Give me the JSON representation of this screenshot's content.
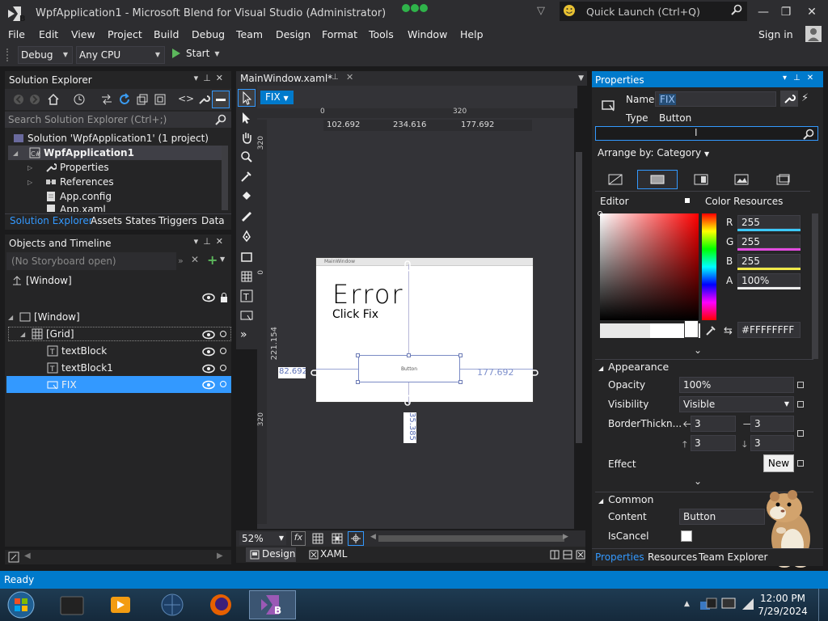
{
  "window": {
    "title": "WpfApplication1 - Microsoft Blend for Visual Studio (Administrator)",
    "quick_launch_placeholder": "Quick Launch (Ctrl+Q)",
    "sign_in": "Sign in"
  },
  "menu": [
    "File",
    "Edit",
    "View",
    "Project",
    "Build",
    "Debug",
    "Team",
    "Design",
    "Format",
    "Tools",
    "Window",
    "Help"
  ],
  "toolbar": {
    "config": "Debug",
    "platform": "Any CPU",
    "start": "Start"
  },
  "solution_explorer": {
    "title": "Solution Explorer",
    "search_placeholder": "Search Solution Explorer (Ctrl+;)",
    "items": [
      {
        "label": "Solution 'WpfApplication1' (1 project)"
      },
      {
        "label": "WpfApplication1"
      },
      {
        "label": "Properties"
      },
      {
        "label": "References"
      },
      {
        "label": "App.config"
      },
      {
        "label": "App.xaml"
      }
    ],
    "tabs": [
      "Solution Explorer",
      "Assets",
      "States",
      "Triggers",
      "Data"
    ]
  },
  "objects_timeline": {
    "title": "Objects and Timeline",
    "storyboard": "(No Storyboard open)",
    "window_root": "[Window]",
    "tree": [
      {
        "label": "[Window]"
      },
      {
        "label": "[Grid]"
      },
      {
        "label": "textBlock"
      },
      {
        "label": "textBlock1"
      },
      {
        "label": "FIX"
      }
    ]
  },
  "document": {
    "tab": "MainWindow.xaml*",
    "selected_badge": "FIX",
    "ruler_top": [
      "0",
      "320"
    ],
    "ruler_left": [
      "320",
      "0",
      "320"
    ],
    "column_measures": [
      "102.692",
      "234.616",
      "177.692"
    ],
    "window_caption": "MainWindow",
    "error_text": "Error",
    "click_text": "Click Fix",
    "button_text": "Button",
    "left_margin": "82.692",
    "right_margin": "177.692",
    "height_measure": "221.154",
    "bottom_measure": "35.385",
    "zoom": "52%",
    "view_tabs": [
      "Design",
      "XAML"
    ]
  },
  "properties": {
    "title": "Properties",
    "name_label": "Name",
    "name_value": "FIX",
    "type_label": "Type",
    "type_value": "Button",
    "arrange_by": "Arrange by: Category",
    "editor_label": "Editor",
    "color_resources": "Color Resources",
    "r_label": "R",
    "r_value": "255",
    "g_label": "G",
    "g_value": "255",
    "b_label": "B",
    "b_value": "255",
    "a_label": "A",
    "a_value": "100%",
    "hex_value": "#FFFFFFFF",
    "appearance": {
      "title": "Appearance",
      "opacity_label": "Opacity",
      "opacity_value": "100%",
      "visibility_label": "Visibility",
      "visibility_value": "Visible",
      "border_label": "BorderThickn...",
      "border_values": [
        "3",
        "3",
        "3",
        "3"
      ],
      "effect_label": "Effect",
      "new_button": "New"
    },
    "common": {
      "title": "Common",
      "content_label": "Content",
      "content_value": "Button",
      "iscancel_label": "IsCancel"
    },
    "tabs": [
      "Properties",
      "Resources",
      "Team Explorer"
    ]
  },
  "status": "Ready",
  "clock": {
    "time": "12:00 PM",
    "date": "7/29/2024"
  },
  "colors": {
    "accent": "#007acc",
    "selection": "#3399ff",
    "panel": "#252526",
    "chrome": "#2d2d30"
  }
}
